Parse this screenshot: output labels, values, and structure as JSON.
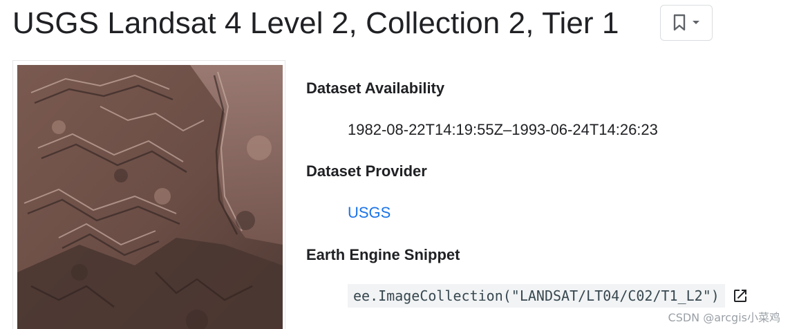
{
  "page": {
    "title": "USGS Landsat 4 Level 2, Collection 2, Tier 1"
  },
  "toolbar": {
    "bookmark_icon": "bookmark-icon",
    "dropdown_icon": "arrow-drop-down-icon"
  },
  "metadata": {
    "availability_label": "Dataset Availability",
    "availability_value": "1982-08-22T14:19:55Z–1993-06-24T14:26:23",
    "provider_label": "Dataset Provider",
    "provider_value": "USGS",
    "snippet_label": "Earth Engine Snippet",
    "snippet_value": "ee.ImageCollection(\"LANDSAT/LT04/C02/T1_L2\")",
    "snippet_open_icon": "open-in-new-icon"
  },
  "watermark": {
    "text": "CSDN @arcgis小菜鸡"
  },
  "colors": {
    "link": "#1a73e8",
    "text": "#202124",
    "code_bg": "#f1f3f4",
    "border": "#dadce0"
  }
}
